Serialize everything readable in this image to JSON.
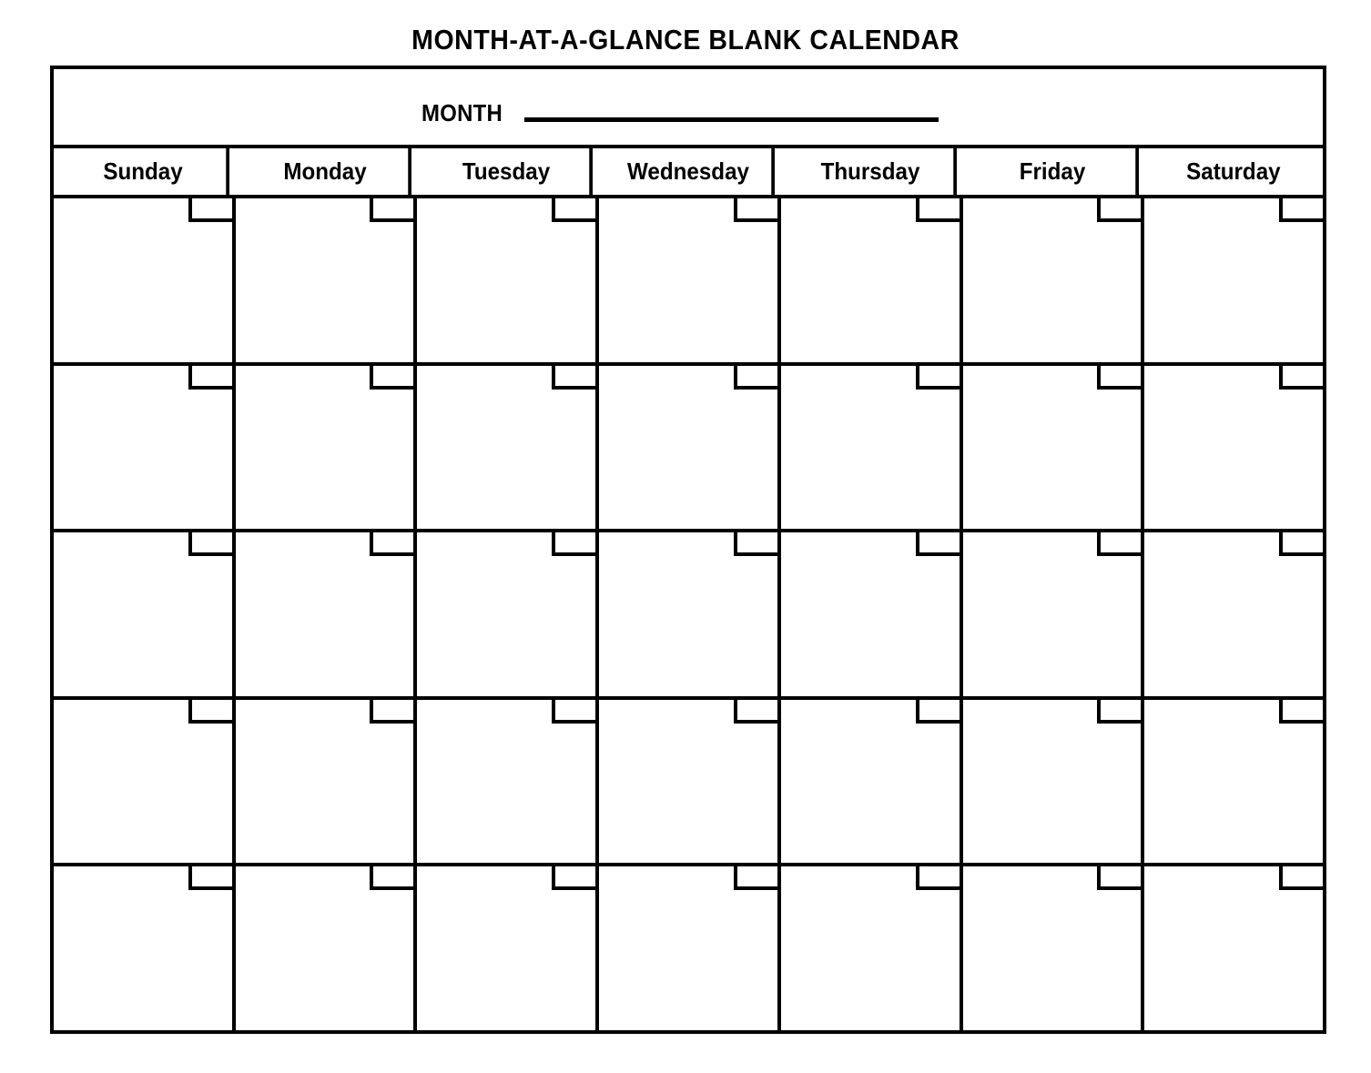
{
  "page": {
    "title": "MONTH-AT-A-GLANCE  BLANK  CALENDAR",
    "background_color": "#ffffff",
    "ink_color": "#000000"
  },
  "calendar": {
    "month_field": {
      "label": "MONTH",
      "value": "",
      "placeholder": "",
      "rule_style": "solid-underline"
    },
    "day_headers": [
      "Sunday",
      "Monday",
      "Tuesday",
      "Wednesday",
      "Thursday",
      "Friday",
      "Saturday"
    ],
    "week_count": 5,
    "weeks": [
      {
        "days": [
          {
            "date": ""
          },
          {
            "date": ""
          },
          {
            "date": ""
          },
          {
            "date": ""
          },
          {
            "date": ""
          },
          {
            "date": ""
          },
          {
            "date": ""
          }
        ]
      },
      {
        "days": [
          {
            "date": ""
          },
          {
            "date": ""
          },
          {
            "date": ""
          },
          {
            "date": ""
          },
          {
            "date": ""
          },
          {
            "date": ""
          },
          {
            "date": ""
          }
        ]
      },
      {
        "days": [
          {
            "date": ""
          },
          {
            "date": ""
          },
          {
            "date": ""
          },
          {
            "date": ""
          },
          {
            "date": ""
          },
          {
            "date": ""
          },
          {
            "date": ""
          }
        ]
      },
      {
        "days": [
          {
            "date": ""
          },
          {
            "date": ""
          },
          {
            "date": ""
          },
          {
            "date": ""
          },
          {
            "date": ""
          },
          {
            "date": ""
          },
          {
            "date": ""
          }
        ]
      },
      {
        "days": [
          {
            "date": ""
          },
          {
            "date": ""
          },
          {
            "date": ""
          },
          {
            "date": ""
          },
          {
            "date": ""
          },
          {
            "date": ""
          },
          {
            "date": ""
          }
        ]
      }
    ]
  }
}
